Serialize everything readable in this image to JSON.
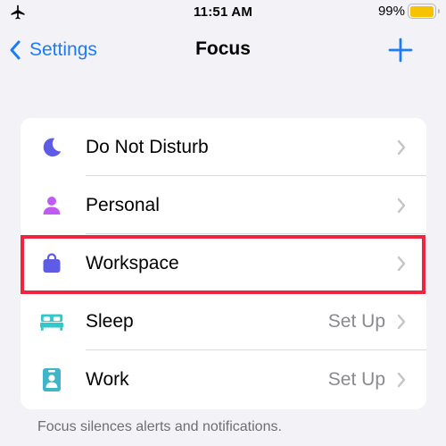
{
  "status_bar": {
    "time": "11:51 AM",
    "battery_percent": "99%",
    "battery_level": 0.99,
    "icons": [
      "airplane-icon",
      "battery-icon"
    ]
  },
  "nav": {
    "back_label": "Settings",
    "title": "Focus",
    "add_icon": "plus-icon"
  },
  "focus_list": [
    {
      "label": "Do Not Disturb",
      "value": "",
      "icon": "moon-icon",
      "icon_color": "#5e5ce6"
    },
    {
      "label": "Personal",
      "value": "",
      "icon": "person-icon",
      "icon_color": "#bf5af2"
    },
    {
      "label": "Workspace",
      "value": "",
      "icon": "bag-icon",
      "icon_color": "#5e5ce6"
    },
    {
      "label": "Sleep",
      "value": "Set Up",
      "icon": "bed-icon",
      "icon_color": "#30c8c8"
    },
    {
      "label": "Work",
      "value": "Set Up",
      "icon": "id-badge-icon",
      "icon_color": "#40b4c8"
    }
  ],
  "footer_note": "Focus silences alerts and notifications.",
  "colors": {
    "accent": "#1c7cf7",
    "highlight": "#f0243c",
    "background": "#f2f2f7",
    "secondary_text": "#8a8a8e"
  }
}
